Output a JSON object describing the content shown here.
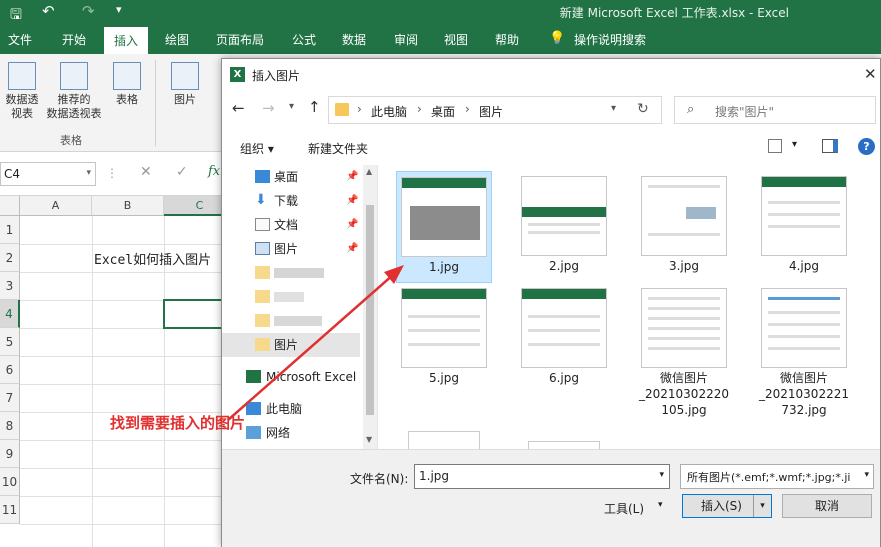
{
  "window": {
    "title": "新建 Microsoft Excel 工作表.xlsx  -  Excel"
  },
  "ribbon": {
    "tabs": [
      "文件",
      "开始",
      "插入",
      "绘图",
      "页面布局",
      "公式",
      "数据",
      "审阅",
      "视图",
      "帮助"
    ],
    "tell_me": "操作说明搜索",
    "buttons": {
      "pivot": "数据透\n视表",
      "recommended_pivot": "推荐的\n数据透视表",
      "table": "表格",
      "picture": "图片"
    },
    "group_label": "表格"
  },
  "formula": {
    "name_box": "C4",
    "fx": "fx"
  },
  "sheet": {
    "columns": [
      "A",
      "B",
      "C"
    ],
    "rows": [
      "1",
      "2",
      "3",
      "4",
      "5",
      "6",
      "7",
      "8",
      "9",
      "10",
      "11"
    ],
    "cell_b2": "Excel如何插入图片"
  },
  "dialog": {
    "title": "插入图片",
    "breadcrumb": [
      "此电脑",
      "桌面",
      "图片"
    ],
    "search_placeholder": "搜索\"图片\"",
    "toolbar": {
      "organize": "组织 ▾",
      "new_folder": "新建文件夹"
    },
    "nav": [
      "桌面",
      "下载",
      "文档",
      "图片",
      "",
      "",
      "",
      "图片",
      "Microsoft Excel",
      "此电脑",
      "网络"
    ],
    "files": [
      {
        "name": "1.jpg"
      },
      {
        "name": "2.jpg"
      },
      {
        "name": "3.jpg"
      },
      {
        "name": "4.jpg"
      },
      {
        "name": "5.jpg"
      },
      {
        "name": "6.jpg"
      },
      {
        "name": "微信图片\n_20210302220\n105.jpg"
      },
      {
        "name": "微信图片\n_20210302221\n732.jpg"
      }
    ],
    "filename_label": "文件名(N):",
    "filename_value": "1.jpg",
    "filetype_value": "所有图片(*.emf;*.wmf;*.jpg;*.ji",
    "tools_label": "工具(L)",
    "insert_label": "插入(S)",
    "cancel_label": "取消"
  },
  "annotation": {
    "text": "找到需要插入的图片",
    "color": "#e03030"
  },
  "colors": {
    "excel_green": "#217346",
    "selection": "#cce8ff"
  }
}
